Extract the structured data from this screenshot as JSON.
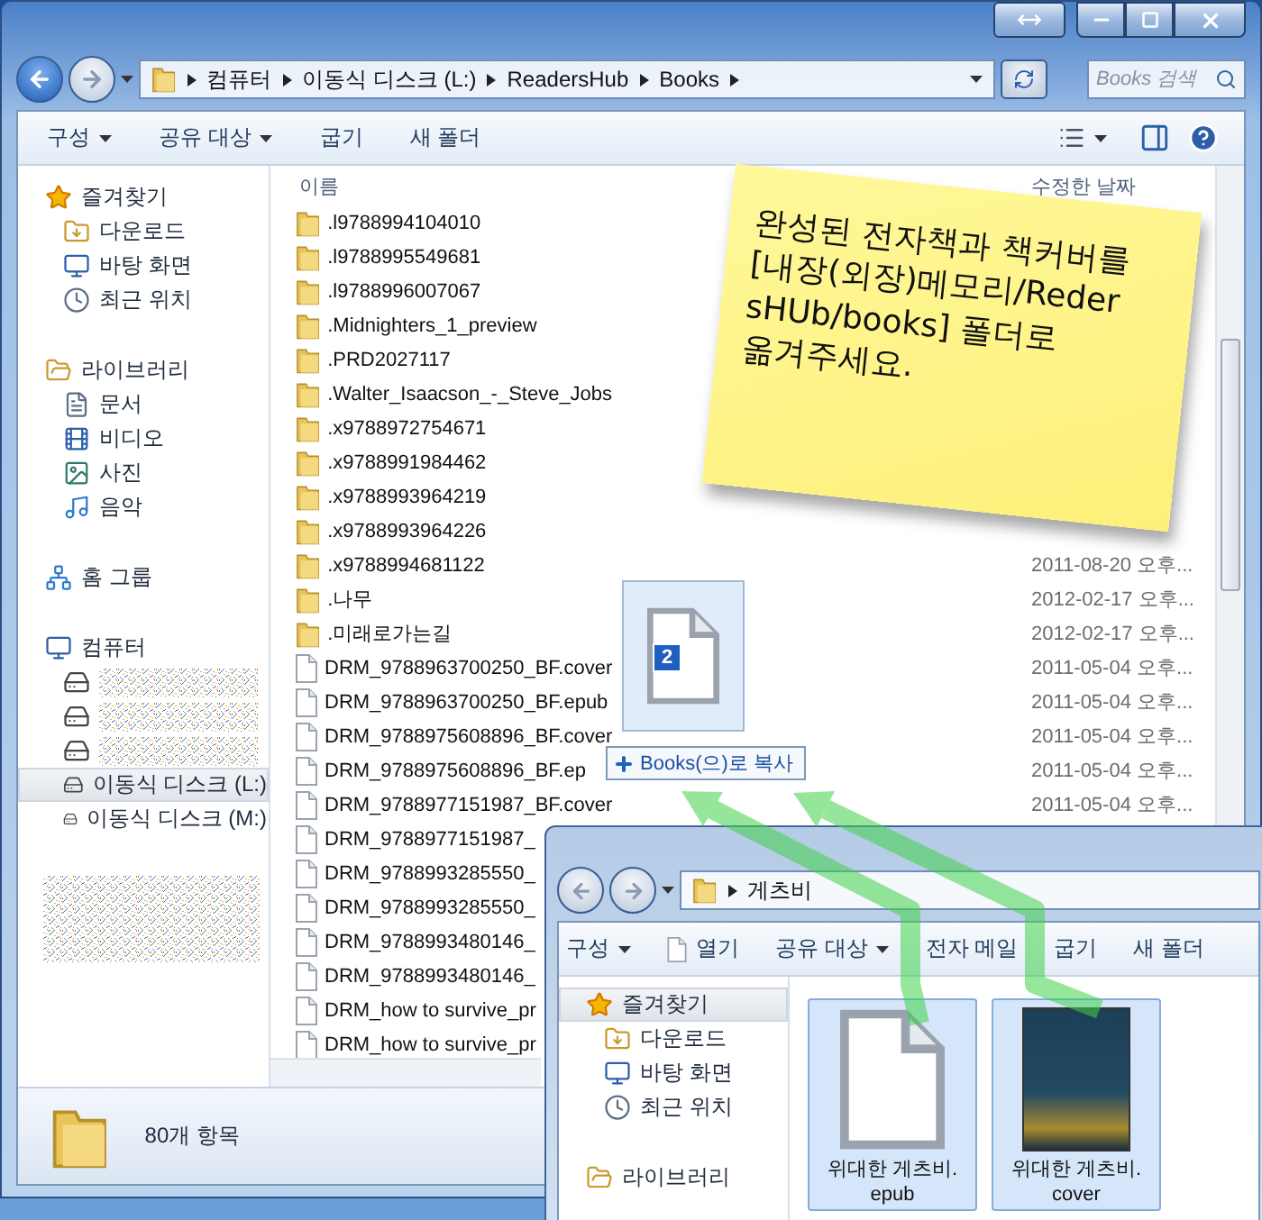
{
  "address_bar": {
    "breadcrumbs": [
      "컴퓨터",
      "이동식 디스크 (L:)",
      "ReadersHub",
      "Books"
    ]
  },
  "search": {
    "placeholder": "Books 검색"
  },
  "toolbar": {
    "items": [
      {
        "label": "구성",
        "dropdown": true
      },
      {
        "label": "공유 대상",
        "dropdown": true
      },
      {
        "label": "굽기",
        "dropdown": false
      },
      {
        "label": "새 폴더",
        "dropdown": false
      }
    ]
  },
  "sidebar": {
    "groups": [
      {
        "label": "즐겨찾기",
        "kind": "favorites",
        "selected": false,
        "children": [
          {
            "label": "다운로드",
            "kind": "downloads",
            "selected": false
          },
          {
            "label": "바탕 화면",
            "kind": "desktop",
            "selected": false
          },
          {
            "label": "최근 위치",
            "kind": "recent",
            "selected": false
          }
        ]
      },
      {
        "label": "라이브러리",
        "kind": "library",
        "selected": false,
        "children": [
          {
            "label": "문서",
            "kind": "documents",
            "selected": false
          },
          {
            "label": "비디오",
            "kind": "videos",
            "selected": false
          },
          {
            "label": "사진",
            "kind": "pictures",
            "selected": false
          },
          {
            "label": "음악",
            "kind": "music",
            "selected": false
          }
        ]
      },
      {
        "label": "홈 그룹",
        "kind": "homegroup",
        "selected": false
      },
      {
        "label": "컴퓨터",
        "kind": "computer",
        "selected": false,
        "children": [
          {
            "kind": "obscured_system_drive",
            "selected": false
          },
          {
            "kind": "obscured_drive",
            "selected": false
          },
          {
            "kind": "obscured_drive",
            "selected": false
          },
          {
            "label": "이동식 디스크 (L:)",
            "kind": "removable_drive",
            "selected": true
          },
          {
            "label": "이동식 디스크 (M:)",
            "kind": "removable_drive",
            "selected": false
          }
        ]
      },
      {
        "kind": "obscured",
        "selected": false
      }
    ]
  },
  "file_list": {
    "columns": [
      "이름",
      "수정한 날짜"
    ],
    "rows": [
      {
        "name": ".l9788994104010",
        "kind": "folder"
      },
      {
        "name": ".l9788995549681",
        "kind": "folder"
      },
      {
        "name": ".l9788996007067",
        "kind": "folder"
      },
      {
        "name": ".Midnighters_1_preview",
        "kind": "folder"
      },
      {
        "name": ".PRD2027117",
        "kind": "folder"
      },
      {
        "name": ".Walter_Isaacson_-_Steve_Jobs",
        "kind": "folder"
      },
      {
        "name": ".x9788972754671",
        "kind": "folder"
      },
      {
        "name": ".x9788991984462",
        "kind": "folder"
      },
      {
        "name": ".x9788993964219",
        "kind": "folder"
      },
      {
        "name": ".x9788993964226",
        "kind": "folder"
      },
      {
        "name": ".x9788994681122",
        "kind": "folder",
        "date": "2011-08-20 오후..."
      },
      {
        "name": ".나무",
        "kind": "folder",
        "date": "2012-02-17 오후..."
      },
      {
        "name": ".미래로가는길",
        "kind": "folder",
        "date": "2012-02-17 오후..."
      },
      {
        "name": "DRM_9788963700250_BF.cover",
        "kind": "file",
        "date": "2011-05-04 오후..."
      },
      {
        "name": "DRM_9788963700250_BF.epub",
        "kind": "file",
        "date": "2011-05-04 오후..."
      },
      {
        "name": "DRM_9788975608896_BF.cover",
        "kind": "file",
        "date": "2011-05-04 오후..."
      },
      {
        "name": "DRM_9788975608896_BF.ep",
        "kind": "file",
        "date": "2011-05-04 오후..."
      },
      {
        "name": "DRM_9788977151987_BF.cover",
        "kind": "file",
        "date": "2011-05-04 오후..."
      },
      {
        "name": "DRM_9788977151987_",
        "kind": "file"
      },
      {
        "name": "DRM_9788993285550_",
        "kind": "file"
      },
      {
        "name": "DRM_9788993285550_",
        "kind": "file"
      },
      {
        "name": "DRM_9788993480146_",
        "kind": "file"
      },
      {
        "name": "DRM_9788993480146_",
        "kind": "file"
      },
      {
        "name": "DRM_how to survive_pr",
        "kind": "file"
      },
      {
        "name": "DRM_how to survive_pr",
        "kind": "file"
      }
    ]
  },
  "status_bar": {
    "count": "80개 항목"
  },
  "sticky_note": {
    "lines": [
      "완성된 전자책과 책커버를",
      "[내장(외장)메모리/Reder",
      "sHUb/books] 폴더로",
      "옮겨주세요."
    ]
  },
  "drag": {
    "badge": "2",
    "tooltip": "Books(으)로 복사"
  },
  "second_window": {
    "breadcrumbs": [
      "게츠비"
    ],
    "toolbar": [
      {
        "label": "구성",
        "dropdown": true,
        "kind": "menu"
      },
      {
        "label": "열기",
        "dropdown": false,
        "kind": "open"
      },
      {
        "label": "공유 대상",
        "dropdown": true,
        "kind": "menu"
      },
      {
        "label": "전자 메일",
        "dropdown": false,
        "kind": "menu"
      },
      {
        "label": "굽기",
        "dropdown": false,
        "kind": "menu"
      },
      {
        "label": "새 폴더",
        "dropdown": false,
        "kind": "menu"
      }
    ],
    "sidebar": [
      {
        "label": "즐겨찾기",
        "kind": "favorites",
        "selected": true
      },
      {
        "label": "다운로드",
        "kind": "downloads",
        "selected": false
      },
      {
        "label": "바탕 화면",
        "kind": "desktop",
        "selected": false
      },
      {
        "label": "최근 위치",
        "kind": "recent",
        "selected": false
      },
      {
        "label": "라이브러리",
        "kind": "library",
        "selected": false
      }
    ],
    "files": [
      {
        "label": "위대한 게츠비.epub",
        "kind": "document",
        "selected": true
      },
      {
        "label": "위대한 게츠비.cover",
        "kind": "image",
        "selected": true
      }
    ]
  }
}
